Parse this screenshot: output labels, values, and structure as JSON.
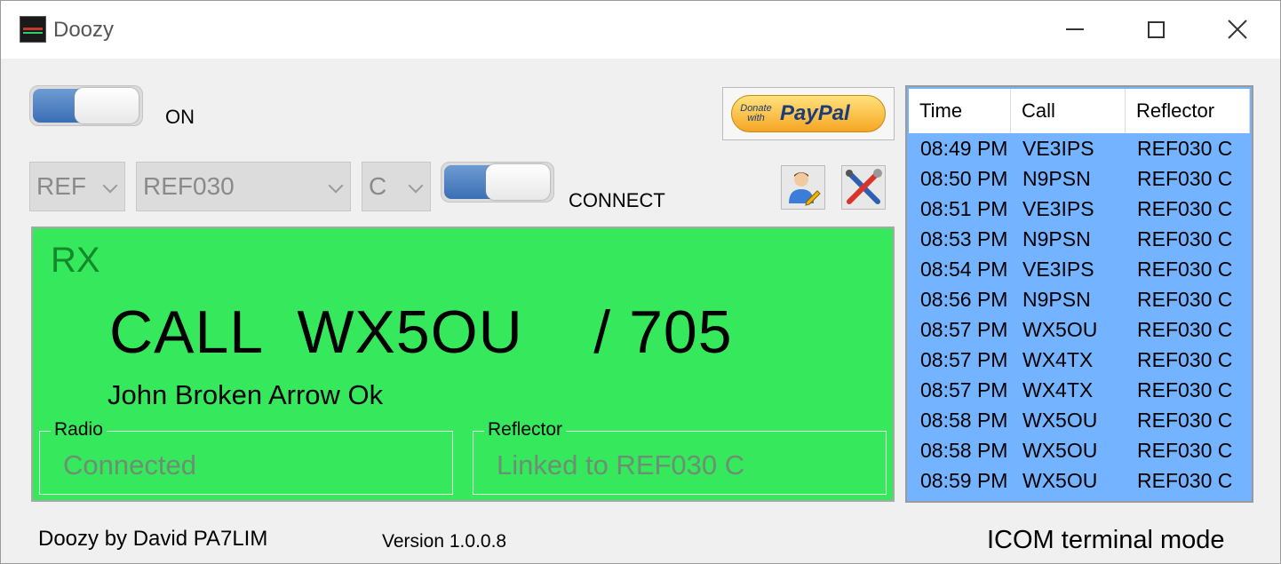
{
  "window": {
    "title": "Doozy"
  },
  "controls": {
    "power_label": "ON",
    "connect_label": "CONNECT",
    "reflector_type": "REF",
    "reflector": "REF030",
    "module": "C",
    "paypal_small": "Donate with",
    "paypal_word": "PayPal"
  },
  "rx": {
    "label": "RX",
    "callsign_line": "CALL  WX5OU    / 705",
    "name": "John Broken Arrow Ok",
    "radio_title": "Radio",
    "radio_status": "Connected",
    "reflector_title": "Reflector",
    "reflector_status": "Linked to REF030 C"
  },
  "log": {
    "columns": [
      "Time",
      "Call",
      "Reflector"
    ],
    "rows": [
      [
        "08:49 PM",
        "VE3IPS",
        "REF030 C"
      ],
      [
        "08:50 PM",
        "N9PSN",
        "REF030 C"
      ],
      [
        "08:51 PM",
        "VE3IPS",
        "REF030 C"
      ],
      [
        "08:53 PM",
        "N9PSN",
        "REF030 C"
      ],
      [
        "08:54 PM",
        "VE3IPS",
        "REF030 C"
      ],
      [
        "08:56 PM",
        "N9PSN",
        "REF030 C"
      ],
      [
        "08:57 PM",
        "WX5OU",
        "REF030 C"
      ],
      [
        "08:57 PM",
        "WX4TX",
        "REF030 C"
      ],
      [
        "08:57 PM",
        "WX4TX",
        "REF030 C"
      ],
      [
        "08:58 PM",
        "WX5OU",
        "REF030 C"
      ],
      [
        "08:58 PM",
        "WX5OU",
        "REF030 C"
      ],
      [
        "08:59 PM",
        "WX5OU",
        "REF030 C"
      ]
    ]
  },
  "footer": {
    "credit": "Doozy by David PA7LIM",
    "version": "Version 1.0.0.8",
    "mode": "ICOM terminal mode"
  },
  "colors": {
    "rx_panel": "#35e85c",
    "log_background": "#73b3ff",
    "toggle_on": "#3a6fb5"
  },
  "icons": {
    "app": "doozy-app-icon",
    "user_edit": "user-edit-icon",
    "settings": "tools-icon"
  }
}
